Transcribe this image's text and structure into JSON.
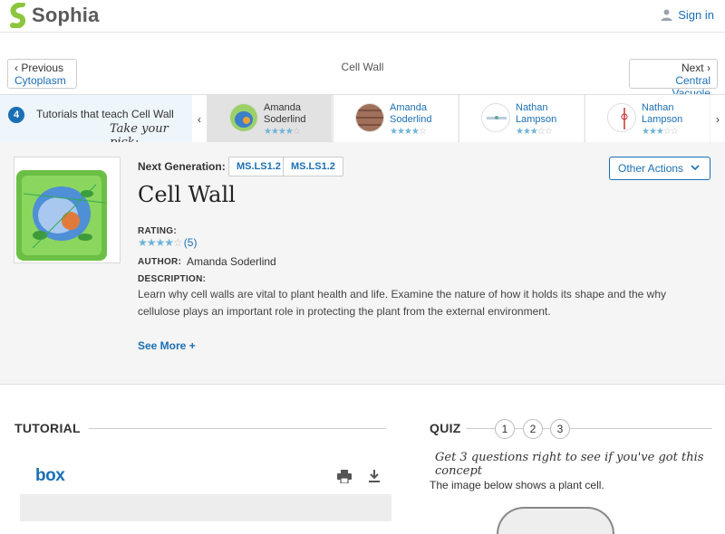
{
  "header": {
    "brand": "Sophia",
    "signin_label": "Sign in"
  },
  "nav": {
    "prev_label": "Previous",
    "prev_target": "Cytoplasm",
    "current": "Cell Wall",
    "next_label": "Next",
    "next_target": "Central Vacuole"
  },
  "tutorials_bar": {
    "count": "4",
    "title": "Tutorials that teach Cell Wall",
    "subtitle": "Take your pick:",
    "picks": [
      {
        "first": "Amanda",
        "last": "Soderlind",
        "rating": 4,
        "active": true
      },
      {
        "first": "Amanda",
        "last": "Soderlind",
        "rating": 4,
        "active": false
      },
      {
        "first": "Nathan",
        "last": "Lampson",
        "rating": 3.5,
        "active": false
      },
      {
        "first": "Nathan",
        "last": "Lampson",
        "rating": 3,
        "active": false
      }
    ]
  },
  "detail": {
    "next_gen_label": "Next Generation:",
    "standards": [
      "MS.LS1.2",
      "MS.LS1.2"
    ],
    "other_actions_label": "Other Actions",
    "title": "Cell Wall",
    "rating_label": "RATING:",
    "rating_value": 4,
    "rating_count": "(5)",
    "author_label": "AUTHOR:",
    "author": "Amanda Soderlind",
    "description_label": "DESCRIPTION:",
    "description": "Learn why cell walls are vital to plant health and life. Examine the nature of how it holds its shape and the why cellulose plays an important role in protecting the plant from the external environment.",
    "see_more": "See More +"
  },
  "tutorial": {
    "heading": "TUTORIAL",
    "viewer_brand": "box"
  },
  "quiz": {
    "heading": "QUIZ",
    "numbers": [
      "1",
      "2",
      "3"
    ],
    "tagline": "Get 3 questions right to see if you've got this concept",
    "question": "The image below shows a plant cell."
  },
  "colors": {
    "accent": "#1a6fb5",
    "star_on": "#6fb3d9",
    "star_off": "#bbbbbb",
    "logo_green": "#8cc63f"
  }
}
